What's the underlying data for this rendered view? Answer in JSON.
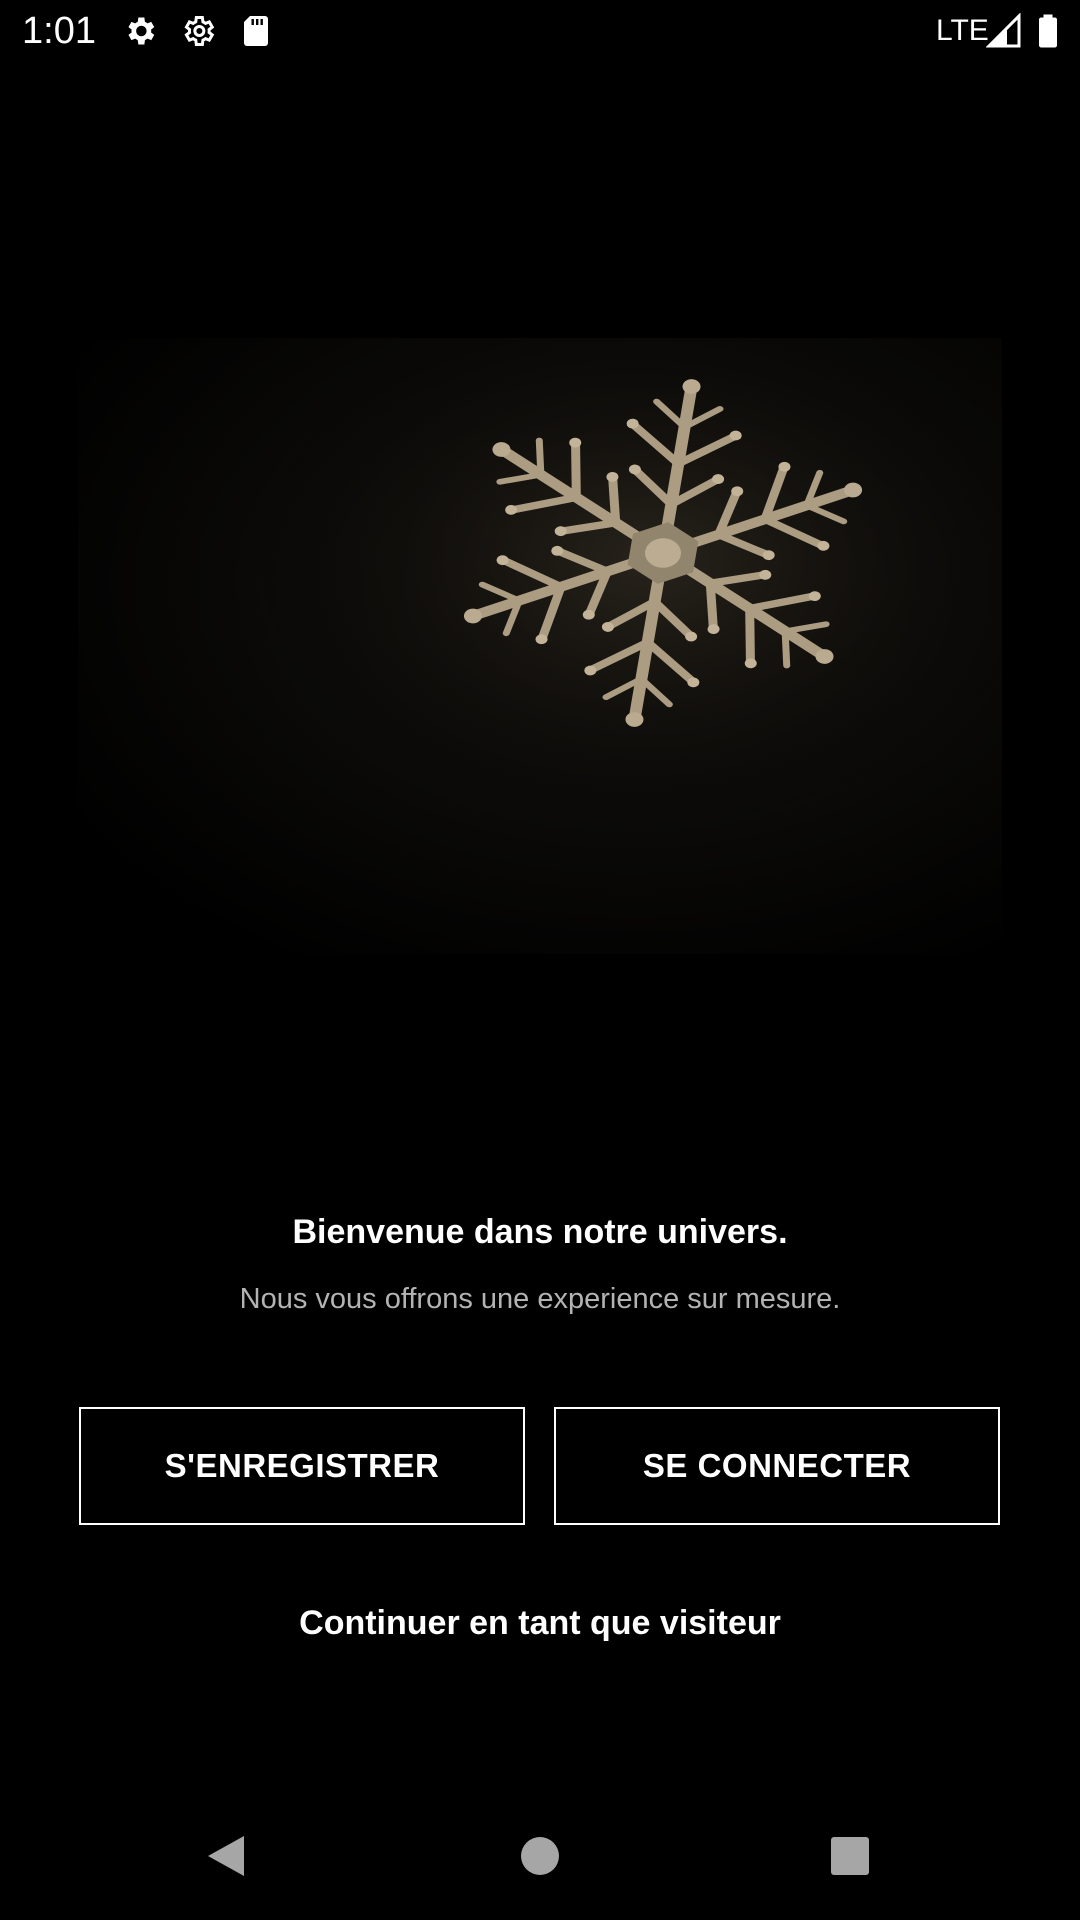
{
  "status_bar": {
    "time": "1:01",
    "network": "LTE",
    "icons": [
      "gear-icon",
      "gear-outline-icon",
      "sd-card-icon",
      "signal-icon",
      "battery-icon"
    ]
  },
  "hero": {
    "image": "snowflake-photo",
    "accent": "#c9b89c"
  },
  "welcome": {
    "title": "Bienvenue dans notre univers.",
    "subtitle": "Nous vous offrons une experience sur mesure."
  },
  "actions": {
    "register_label": "S'ENREGISTRER",
    "login_label": "SE CONNECTER",
    "guest_label": "Continuer en tant que visiteur"
  },
  "nav_bar": {
    "icons": [
      "back-icon",
      "home-icon",
      "recents-icon"
    ]
  },
  "colors": {
    "background": "#000000",
    "text": "#ffffff",
    "subtitle": "#b3b3b3",
    "button_border": "#ffffff"
  }
}
